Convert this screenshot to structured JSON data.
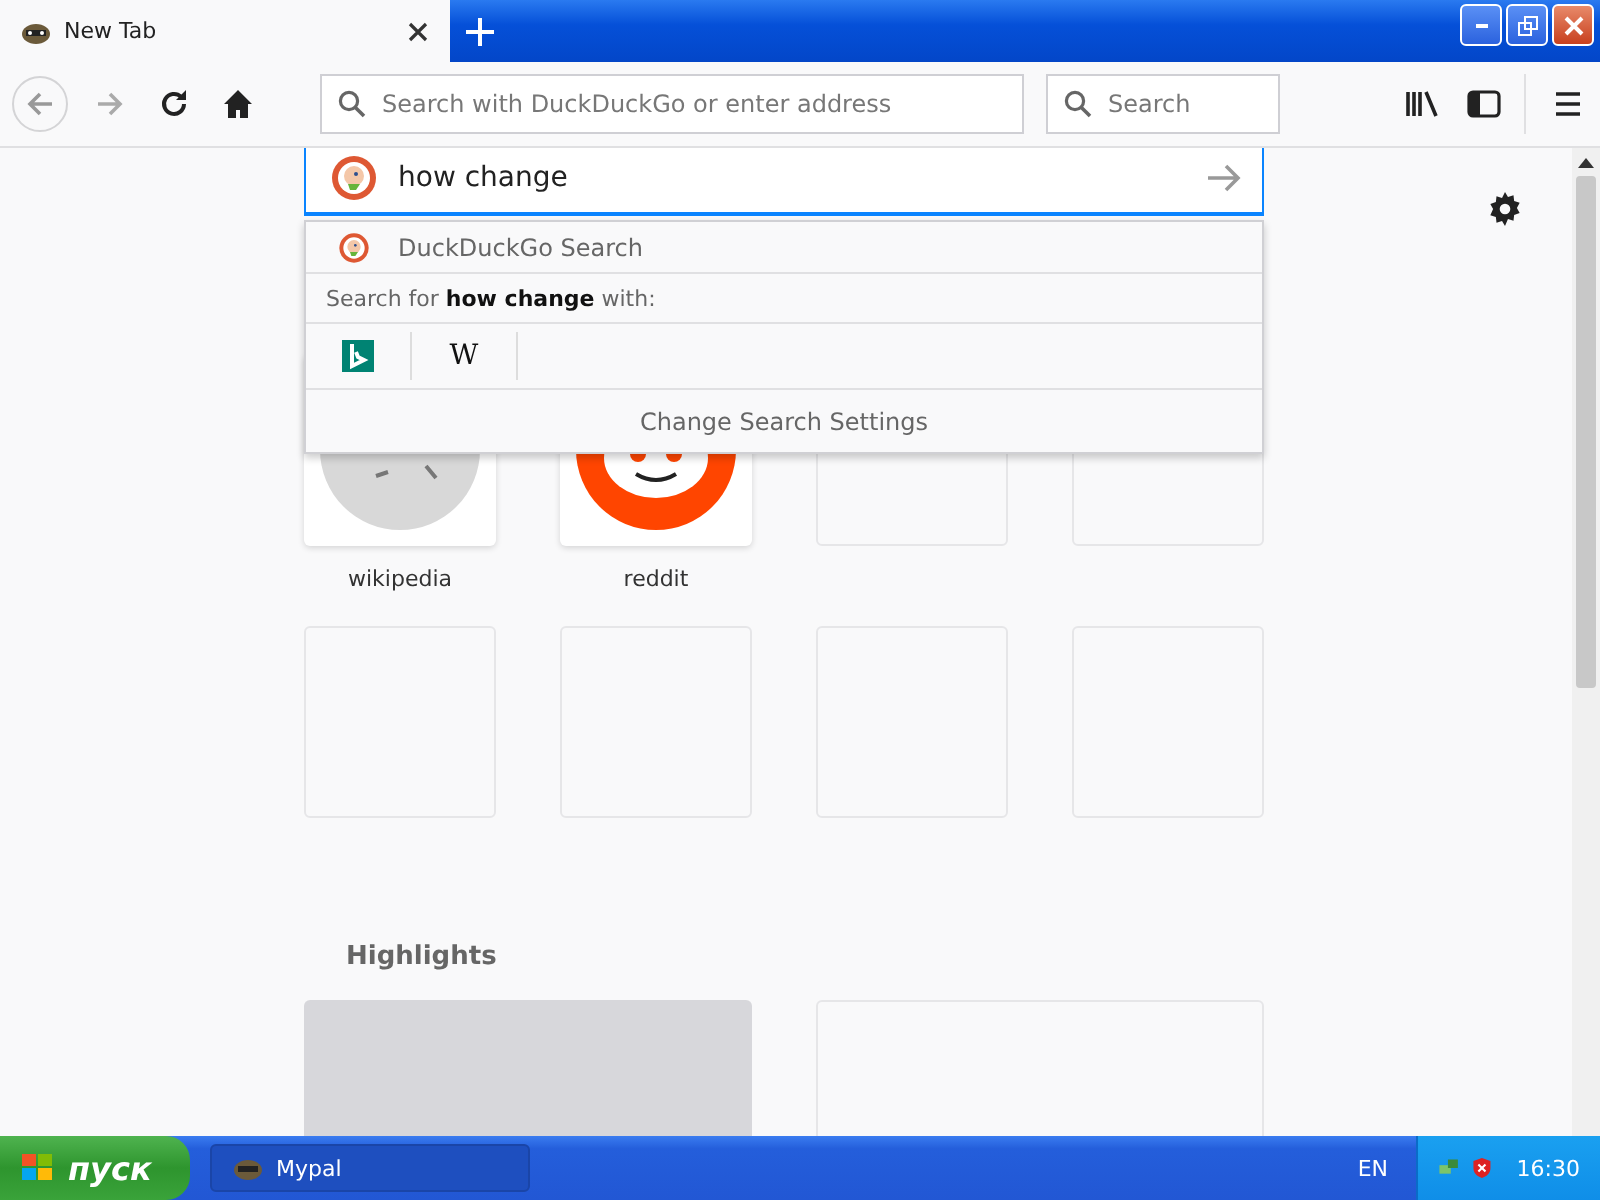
{
  "tab": {
    "title": "New Tab",
    "selected": true
  },
  "toolbar": {
    "forward_disabled": true,
    "address_placeholder": "Search with DuckDuckGo or enter address",
    "search_placeholder": "Search"
  },
  "search_box": {
    "value": "how change"
  },
  "dropdown": {
    "engine_label": "DuckDuckGo Search",
    "prompt": "Search for **how change** with:",
    "engines": [
      {
        "kind": "bing"
      },
      {
        "kind": "wikipedia",
        "glyph": "W"
      }
    ],
    "settings_button": "Change Search Settings"
  },
  "top_sites": [
    {
      "kind": "wikipedia",
      "label": "wikipedia"
    },
    {
      "kind": "reddit",
      "label": "reddit"
    },
    {
      "kind": "empty"
    },
    {
      "kind": "empty"
    },
    {
      "kind": "empty"
    },
    {
      "kind": "empty"
    },
    {
      "kind": "empty"
    },
    {
      "kind": "empty"
    }
  ],
  "highlights": {
    "title": "Highlights",
    "cards": [
      {
        "kind": "loading"
      },
      {
        "kind": "empty"
      }
    ]
  },
  "taskbar": {
    "start": "пуск",
    "task": "Mypal",
    "language": "EN",
    "clock": "16:30"
  }
}
